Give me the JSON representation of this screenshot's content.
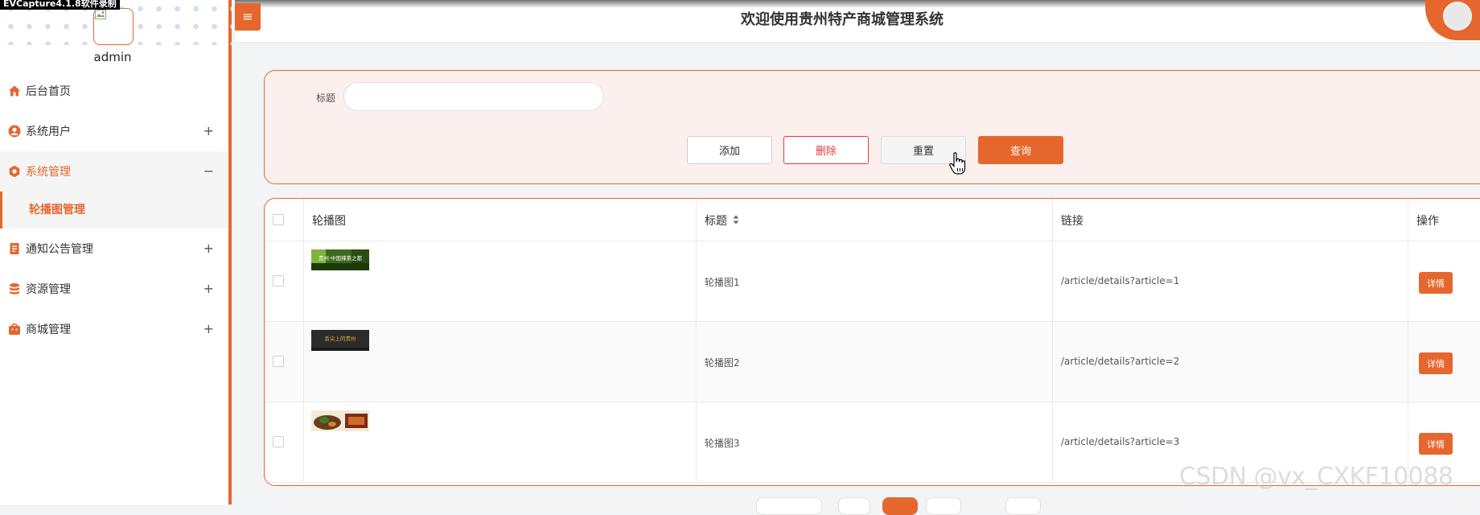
{
  "recorder_badge": "EVCapture4.1.8软件录制",
  "user": {
    "name": "admin"
  },
  "header": {
    "menu_icon": "≡",
    "title": "欢迎使用贵州特产商城管理系统"
  },
  "sidebar": {
    "items": [
      {
        "label": "后台首页",
        "icon": "home-icon",
        "toggle": ""
      },
      {
        "label": "系统用户",
        "icon": "user-icon",
        "toggle": "+"
      },
      {
        "label": "系统管理",
        "icon": "settings-icon",
        "toggle": "−"
      },
      {
        "label": "通知公告管理",
        "icon": "notice-icon",
        "toggle": "+"
      },
      {
        "label": "资源管理",
        "icon": "database-icon",
        "toggle": "+"
      },
      {
        "label": "商城管理",
        "icon": "shop-icon",
        "toggle": "+"
      }
    ],
    "subitem": {
      "label": "轮播图管理"
    }
  },
  "search": {
    "label": "标题",
    "value": "",
    "placeholder": "",
    "buttons": {
      "add": "添加",
      "delete": "删除",
      "reset": "重置",
      "query": "查询"
    }
  },
  "table": {
    "headers": {
      "image": "轮播图",
      "title": "标题",
      "link": "链接",
      "action": "操作"
    },
    "rows": [
      {
        "title": "轮播图1",
        "link": "/article/details?article=1",
        "action": "详情",
        "image_text": "贵州·中国辣茶之都"
      },
      {
        "title": "轮播图2",
        "link": "/article/details?article=2",
        "action": "详情",
        "image_text": "舌尖上的贵州"
      },
      {
        "title": "轮播图3",
        "link": "/article/details?article=3",
        "action": "详情",
        "image_text": ""
      }
    ]
  },
  "watermark": "CSDN @vx_CXKF10088",
  "colors": {
    "accent": "#e5672e",
    "danger": "#e23a3a",
    "panel_bg": "#fbf0ed"
  }
}
